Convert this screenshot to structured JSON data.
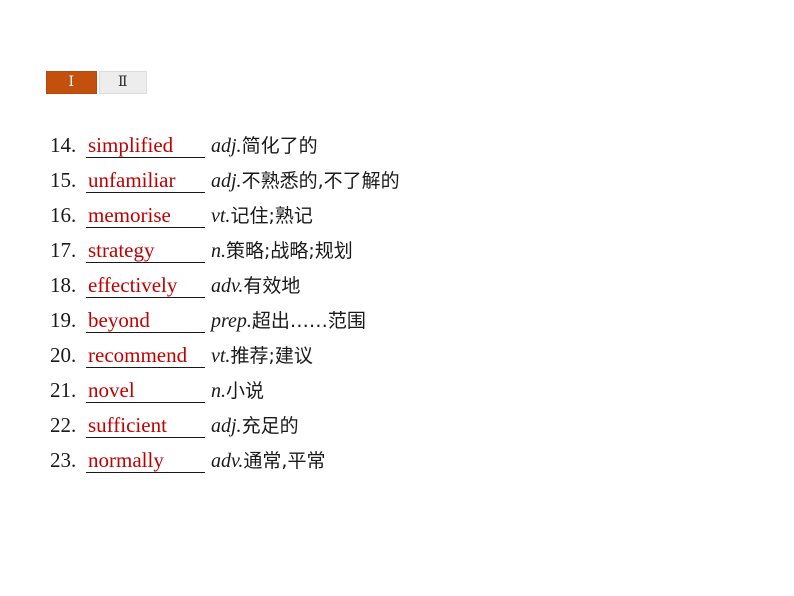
{
  "tabs": [
    {
      "label": "Ⅰ",
      "name": "tab-one",
      "active": true
    },
    {
      "label": "Ⅱ",
      "name": "tab-two",
      "active": false
    }
  ],
  "theme": {
    "active_tab_bg": "#c4500e",
    "inactive_tab_bg": "#ededed",
    "answer_color": "#c00000",
    "text_color": "#1a1a1a",
    "page_bg": "#ffffff"
  },
  "vocabulary": [
    {
      "number": "14.",
      "word": "simplified",
      "pos": "adj.",
      "meaning": "简化了的"
    },
    {
      "number": "15.",
      "word": "unfamiliar",
      "pos": "adj.",
      "meaning": "不熟悉的,不了解的"
    },
    {
      "number": "16.",
      "word": "memorise",
      "pos": "vt.",
      "meaning": "记住;熟记"
    },
    {
      "number": "17.",
      "word": "strategy",
      "pos": "n.",
      "meaning": "策略;战略;规划"
    },
    {
      "number": "18.",
      "word": "effectively",
      "pos": "adv.",
      "meaning": "有效地"
    },
    {
      "number": "19.",
      "word": "beyond",
      "pos": "prep.",
      "meaning": "超出……范围"
    },
    {
      "number": "20.",
      "word": "recommend",
      "pos": "vt.",
      "meaning": "推荐;建议"
    },
    {
      "number": "21.",
      "word": "novel",
      "pos": "n.",
      "meaning": "小说"
    },
    {
      "number": "22.",
      "word": "sufficient",
      "pos": "adj.",
      "meaning": "充足的"
    },
    {
      "number": "23.",
      "word": "normally",
      "pos": "adv.",
      "meaning": "通常,平常"
    }
  ]
}
